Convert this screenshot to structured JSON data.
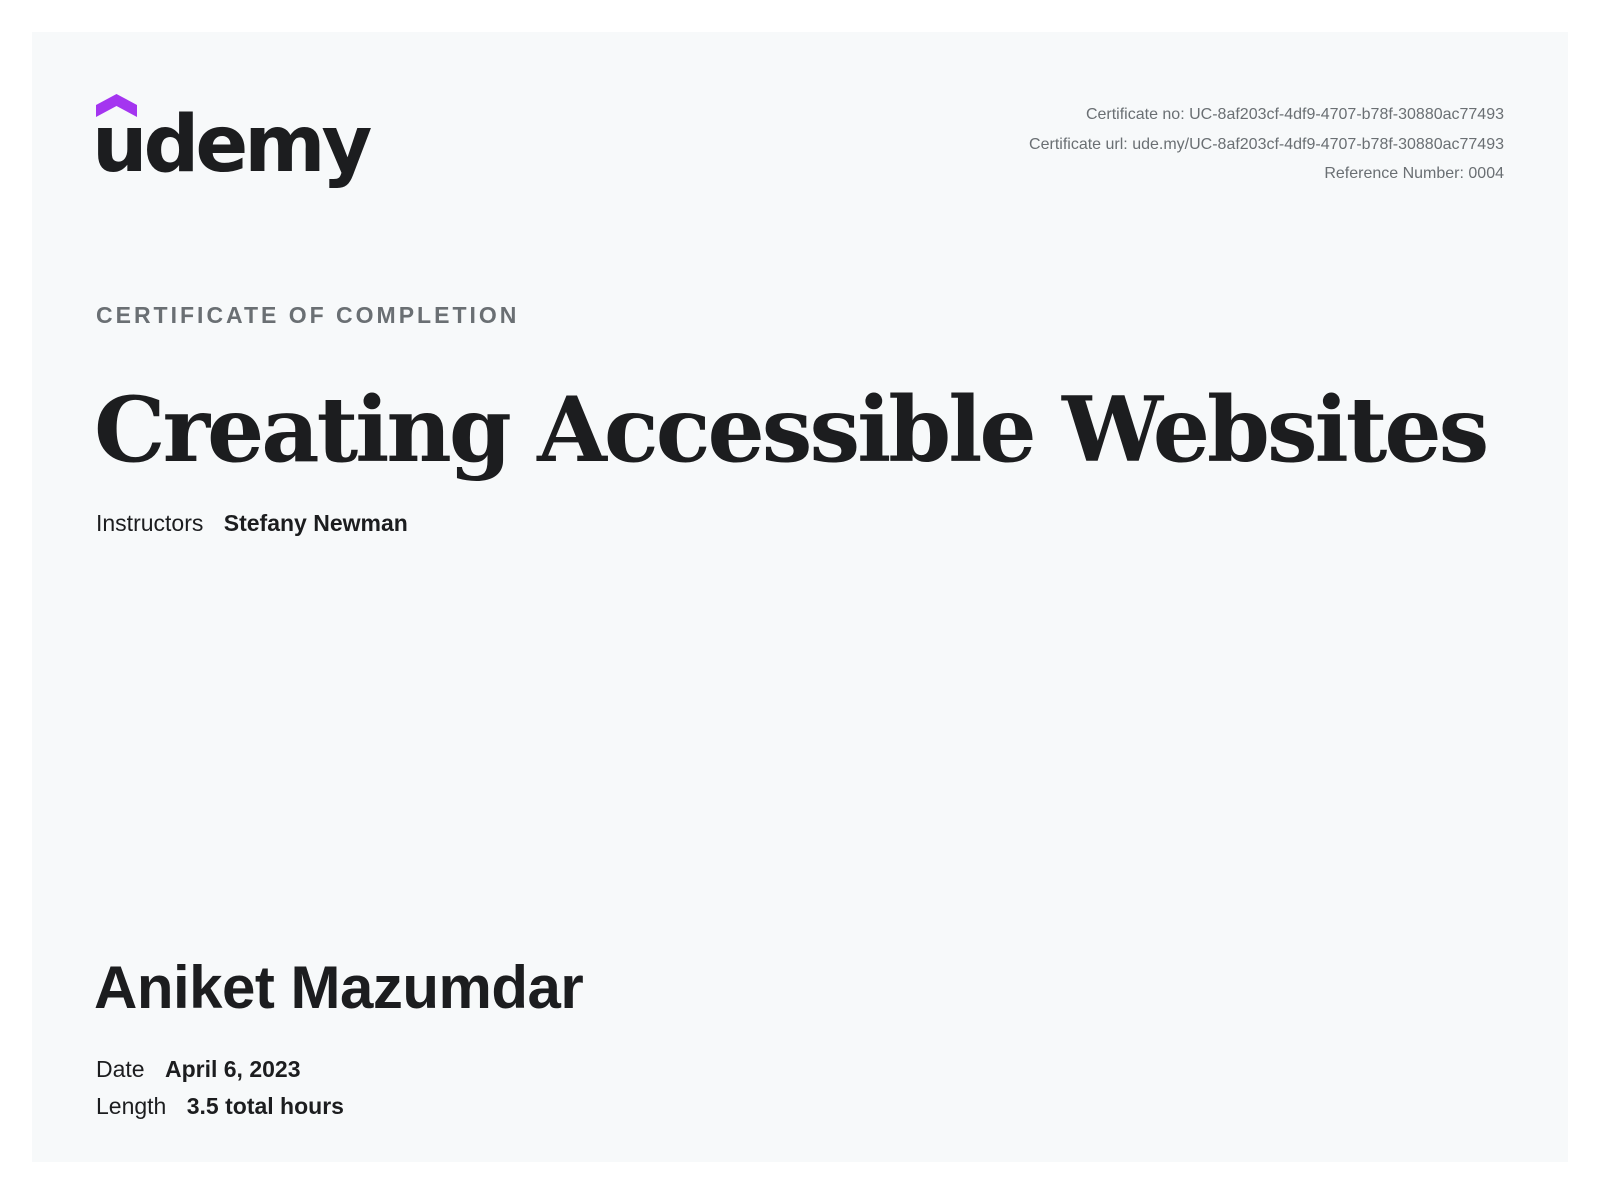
{
  "logo": {
    "text": "udemy",
    "icon": "udemy-hat-icon",
    "accent_color": "#a435f0"
  },
  "certificate": {
    "number_label": "Certificate no:",
    "number": "UC-8af203cf-4df9-4707-b78f-30880ac77493",
    "url_label": "Certificate url:",
    "url": "ude.my/UC-8af203cf-4df9-4707-b78f-30880ac77493",
    "reference_label": "Reference Number:",
    "reference": "0004",
    "heading": "CERTIFICATE OF COMPLETION"
  },
  "course": {
    "title": "Creating Accessible Websites",
    "instructors_label": "Instructors",
    "instructors": "Stefany Newman"
  },
  "recipient": {
    "name": "Aniket Mazumdar"
  },
  "details": {
    "date_label": "Date",
    "date": "April 6, 2023",
    "length_label": "Length",
    "length": "3.5 total hours"
  }
}
